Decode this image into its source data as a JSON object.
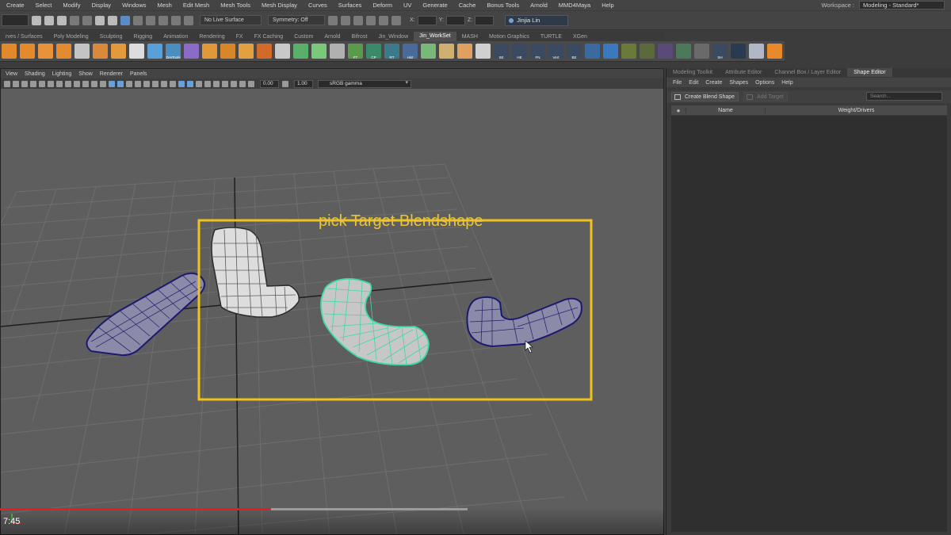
{
  "menubar": {
    "items": [
      "Create",
      "Select",
      "Modify",
      "Display",
      "Windows",
      "Mesh",
      "Edit Mesh",
      "Mesh Tools",
      "Mesh Display",
      "Curves",
      "Surfaces",
      "Deform",
      "UV",
      "Generate",
      "Cache",
      "Bonus Tools",
      "Arnold",
      "MMD4Maya",
      "Help"
    ],
    "workspace_label": "Workspace :",
    "workspace_value": "Modeling - Standard*"
  },
  "statusline": {
    "live_surface": "No Live Surface",
    "symmetry": "Symmetry: Off",
    "x_label": "X:",
    "y_label": "Y:",
    "z_label": "Z:",
    "user": "Jinjia Lin"
  },
  "shelf": {
    "tabs": [
      "rves / Surfaces",
      "Poly Modeling",
      "Sculpting",
      "Rigging",
      "Animation",
      "Rendering",
      "FX",
      "FX Caching",
      "Custom",
      "Arnold",
      "Bifrost",
      "Jin_Window",
      "Jin_WorkSet",
      "MASH",
      "Motion Graphics",
      "TURTLE",
      "XGen"
    ],
    "active_tab": 12,
    "button_labels": [
      "ZenTools",
      "FT",
      "CP",
      "RT",
      "Hist",
      "SE",
      "HE",
      "FN",
      "Vert",
      "BE",
      "SH"
    ]
  },
  "viewport": {
    "menu": [
      "View",
      "Shading",
      "Lighting",
      "Show",
      "Renderer",
      "Panels"
    ],
    "exposure": "0.00",
    "gamma": "1.00",
    "color_space": "sRGB gamma",
    "overlay_text": "pick Target Blendshape",
    "camera": "persp"
  },
  "player": {
    "time": "7:45",
    "progress": 0.285,
    "buffered": 0.5
  },
  "right_panel": {
    "tabs": [
      "Modeling Toolkit",
      "Attribute Editor",
      "Channel Box / Layer Editor",
      "Shape Editor"
    ],
    "active_tab": 3,
    "menu": [
      "File",
      "Edit",
      "Create",
      "Shapes",
      "Options",
      "Help"
    ],
    "create_blend_shape": "Create Blend Shape",
    "add_target": "Add Target",
    "search_placeholder": "Search...",
    "col_name": "Name",
    "col_weight": "Weight/Drivers"
  }
}
